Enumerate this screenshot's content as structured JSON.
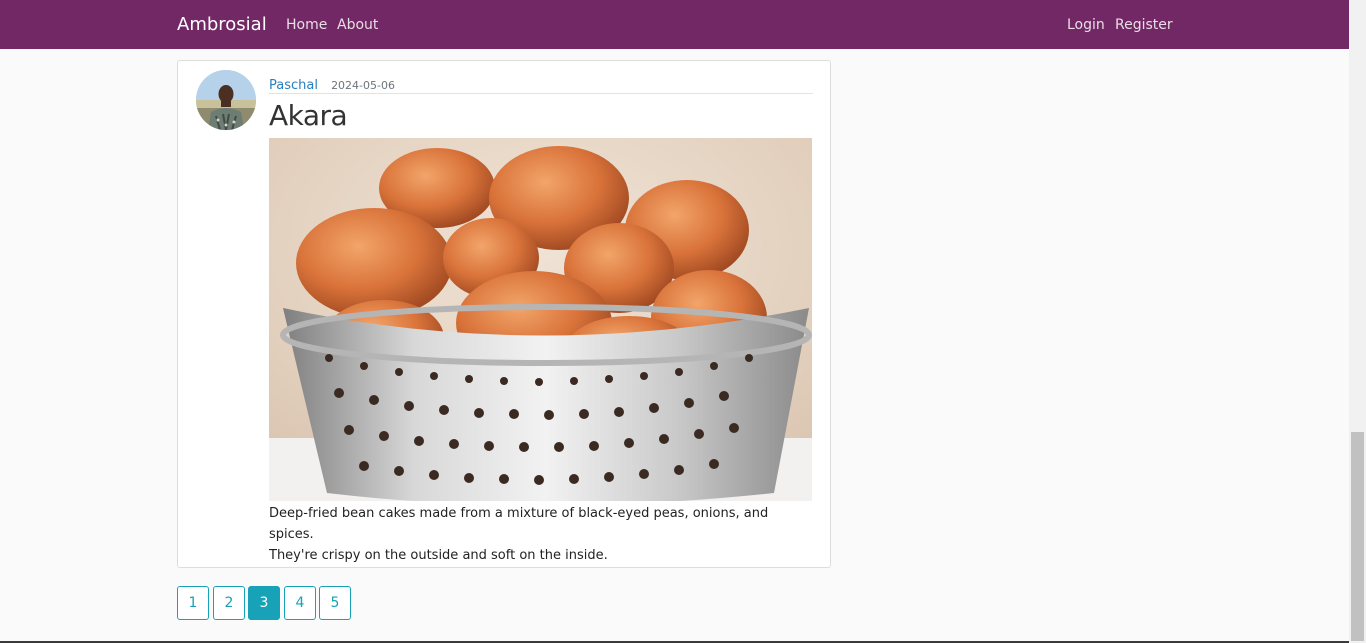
{
  "navbar": {
    "brand": "Ambrosial",
    "left_links": [
      "Home",
      "About"
    ],
    "right_links": [
      "Login",
      "Register"
    ],
    "background": "#732866"
  },
  "post": {
    "author": "Paschal",
    "date": "2024-05-06",
    "title": "Akara",
    "content_line1": "Deep-fried bean cakes made from a mixture of black-eyed peas, onions, and spices.",
    "content_line2": "They're crispy on the outside and soft on the inside."
  },
  "pagination": {
    "pages": [
      "1",
      "2",
      "3",
      "4",
      "5"
    ],
    "current": "3",
    "accent": "#17a2b8"
  }
}
